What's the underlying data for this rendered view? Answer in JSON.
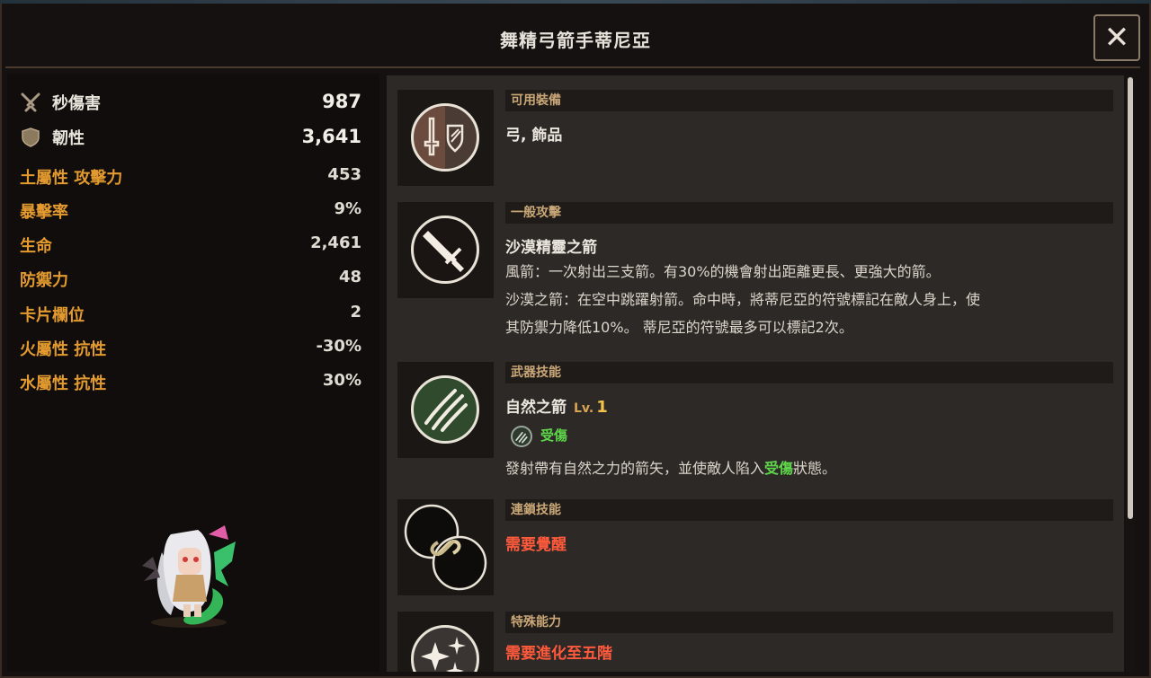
{
  "window": {
    "title": "舞精弓箭手蒂尼亞",
    "close_label": "✕"
  },
  "stats": {
    "major": [
      {
        "label": "秒傷害",
        "value": "987",
        "icon": "crossed-swords-icon"
      },
      {
        "label": "韌性",
        "value": "3,641",
        "icon": "shield-icon"
      }
    ],
    "minor": [
      {
        "label": "土屬性 攻擊力",
        "value": "453"
      },
      {
        "label": "暴擊率",
        "value": "9%"
      },
      {
        "label": "生命",
        "value": "2,461"
      },
      {
        "label": "防禦力",
        "value": "48"
      },
      {
        "label": "卡片欄位",
        "value": "2"
      },
      {
        "label": "火屬性 抗性",
        "value": "-30%"
      },
      {
        "label": "水屬性 抗性",
        "value": "30%"
      }
    ]
  },
  "sections": {
    "equipment": {
      "header": "可用裝備",
      "text": "弓, 飾品"
    },
    "normal_attack": {
      "header": "一般攻擊",
      "name": "沙漠精靈之箭",
      "lines": [
        "風箭：一次射出三支箭。有30%的機會射出距離更長、更強大的箭。",
        "沙漠之箭：在空中跳躍射箭。命中時，將蒂尼亞的符號標記在敵人身上，使",
        "其防禦力降低10%。 蒂尼亞的符號最多可以標記2次。"
      ]
    },
    "weapon_skill": {
      "header": "武器技能",
      "name": "自然之箭",
      "lv_label": "Lv.",
      "lv_value": "1",
      "debuff_label": "受傷",
      "desc_before": "發射帶有自然之力的箭矢，並使敵人陷入",
      "desc_highlight": "受傷",
      "desc_after": "狀態。"
    },
    "chain_skill": {
      "header": "連鎖技能",
      "text": "需要覺醒"
    },
    "special": {
      "header": "特殊能力",
      "text": "需要進化至五階"
    }
  },
  "colors": {
    "stat_label_orange": "#e39a2f",
    "locked_red": "#ff5a3c",
    "debuff_green": "#5ed64b",
    "section_header": "#c9a777",
    "weapon_skill_green": "#2f4a2c"
  }
}
